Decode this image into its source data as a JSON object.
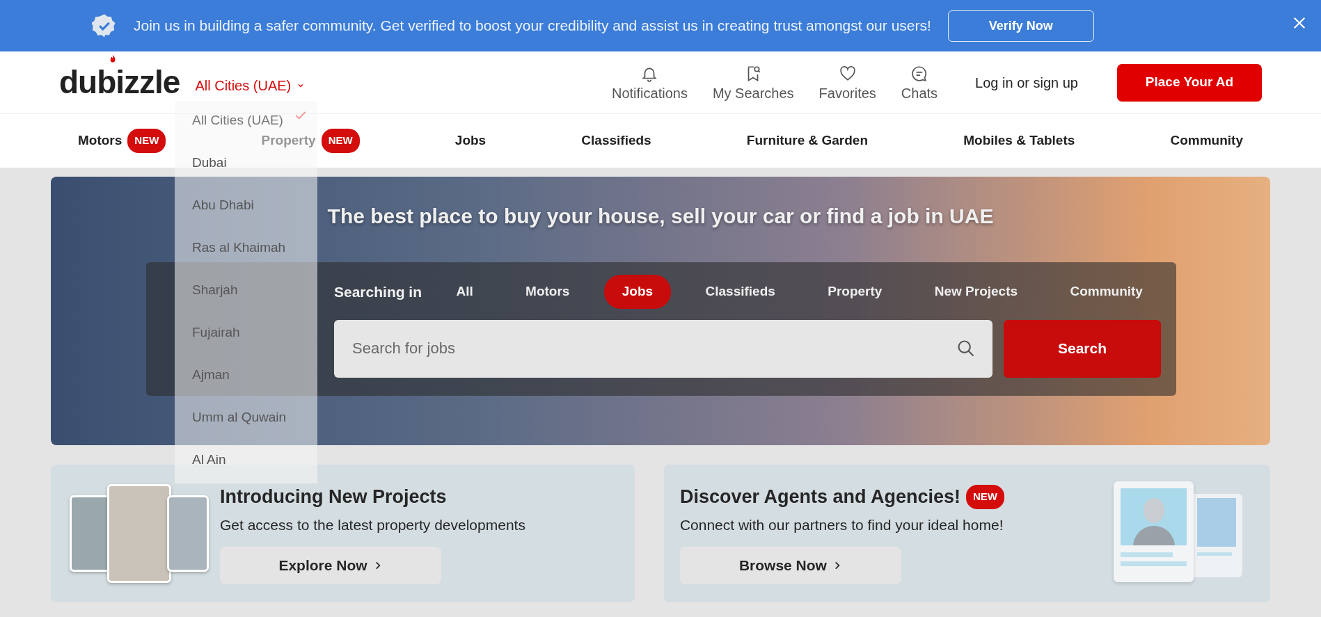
{
  "banner": {
    "text": "Join us in building a safer community. Get verified to boost your credibility and assist us in creating trust amongst our users!",
    "button": "Verify Now"
  },
  "header": {
    "logo": "dubizzle",
    "city_selector": "All Cities (UAE)",
    "city_dropdown": [
      {
        "label": "All Cities (UAE)",
        "selected": true
      },
      {
        "label": "Dubai",
        "selected": false
      },
      {
        "label": "Abu Dhabi",
        "selected": false
      },
      {
        "label": "Ras al Khaimah",
        "selected": false
      },
      {
        "label": "Sharjah",
        "selected": false
      },
      {
        "label": "Fujairah",
        "selected": false
      },
      {
        "label": "Ajman",
        "selected": false
      },
      {
        "label": "Umm al Quwain",
        "selected": false
      },
      {
        "label": "Al Ain",
        "selected": false
      }
    ],
    "actions": [
      {
        "label": "Notifications",
        "kind": "bell"
      },
      {
        "label": "My Searches",
        "kind": "saved"
      },
      {
        "label": "Favorites",
        "kind": "heart"
      },
      {
        "label": "Chats",
        "kind": "chat"
      }
    ],
    "login": "Log in or sign up",
    "place_ad": "Place Your Ad"
  },
  "categories": [
    {
      "label": "Motors",
      "badge": "NEW"
    },
    {
      "label": "Property",
      "badge": "NEW"
    },
    {
      "label": "Jobs"
    },
    {
      "label": "Classifieds"
    },
    {
      "label": "Furniture & Garden"
    },
    {
      "label": "Mobiles & Tablets"
    },
    {
      "label": "Community"
    }
  ],
  "hero": {
    "title": "The best place to buy your house, sell your car or find a job in UAE",
    "searching_label": "Searching in",
    "tabs": [
      {
        "label": "All",
        "selected": false
      },
      {
        "label": "Motors",
        "selected": false
      },
      {
        "label": "Jobs",
        "selected": true
      },
      {
        "label": "Classifieds",
        "selected": false
      },
      {
        "label": "Property",
        "selected": false
      },
      {
        "label": "New Projects",
        "selected": false
      },
      {
        "label": "Community",
        "selected": false
      }
    ],
    "search_placeholder": "Search for jobs",
    "search_button": "Search"
  },
  "promos": [
    {
      "kind": "projects",
      "title": "Introducing New Projects",
      "text": "Get access to the latest property developments",
      "button": "Explore Now"
    },
    {
      "kind": "agents",
      "title": "Discover Agents and Agencies!",
      "badge": "NEW",
      "text": "Connect with our partners to find your ideal home!",
      "button": "Browse Now"
    }
  ]
}
